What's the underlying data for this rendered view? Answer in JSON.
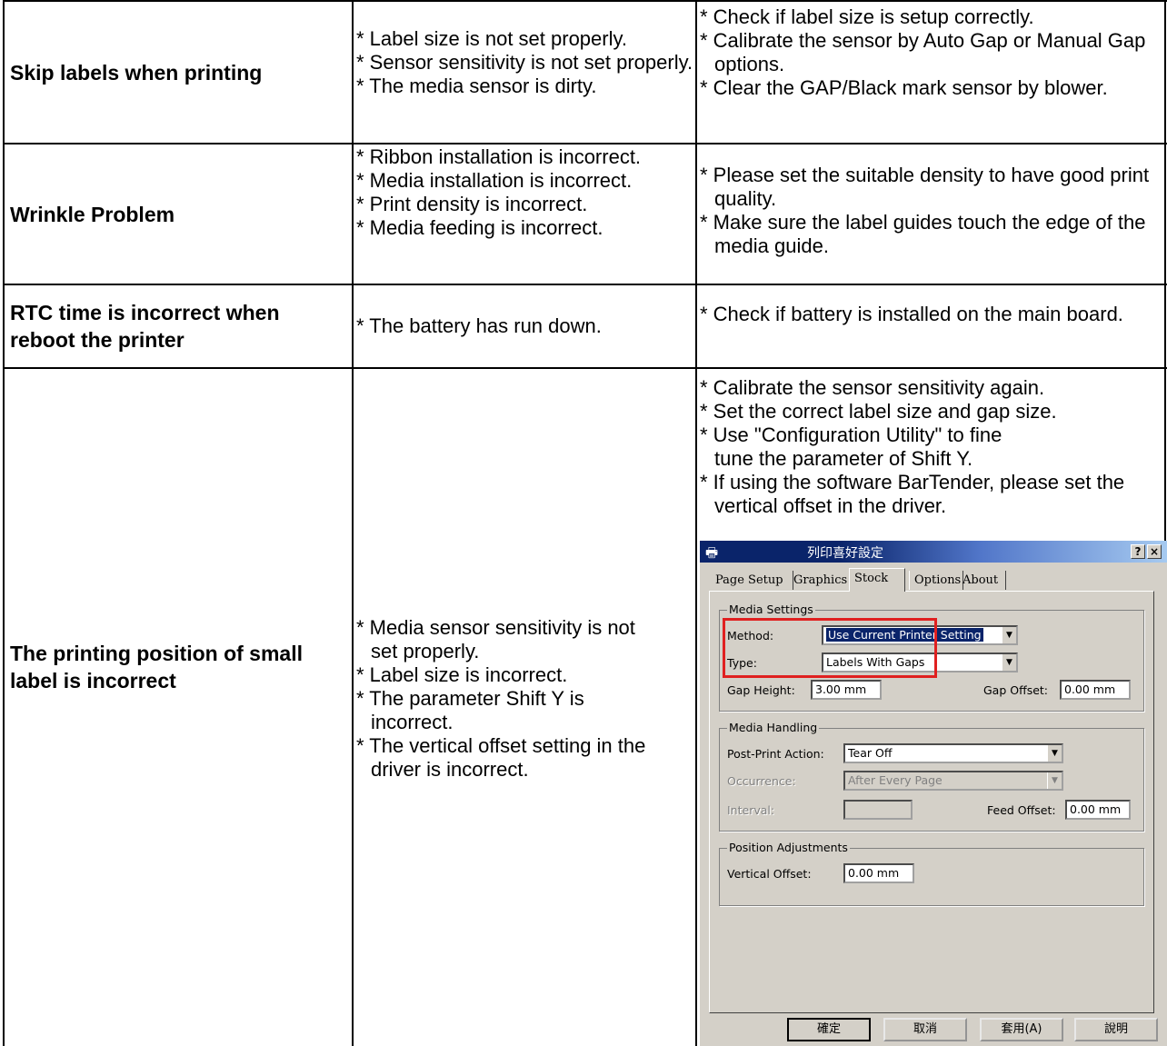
{
  "rows": [
    {
      "problem": "Skip labels when printing",
      "causes": [
        "* Label size is not set properly.",
        "* Sensor sensitivity is not set properly.",
        "* The media sensor is dirty."
      ],
      "solutions": [
        "* Check if label size is setup correctly.",
        "* Calibrate the sensor by Auto Gap or Manual Gap options.",
        "* Clear the GAP/Black mark sensor by blower."
      ]
    },
    {
      "problem": "Wrinkle Problem",
      "causes": [
        "* Ribbon installation is incorrect.",
        "* Media installation is incorrect.",
        "* Print density is incorrect.",
        "* Media feeding is incorrect."
      ],
      "solutions": [
        "* Please set the suitable density to have good print quality.",
        "* Make sure the label guides touch the edge of the media guide."
      ]
    },
    {
      "problem": "RTC time is incorrect when reboot the printer",
      "causes": [
        "* The battery has run down."
      ],
      "solutions": [
        "* Check if battery is installed on the main board."
      ]
    },
    {
      "problem": "The printing position of small label is incorrect",
      "causes": [
        "* Media sensor sensitivity is not set properly.",
        "* Label size is incorrect.",
        "* The parameter Shift Y is incorrect.",
        "* The vertical offset setting in the driver is incorrect."
      ],
      "solutions": [
        "* Calibrate the sensor sensitivity again.",
        "* Set the correct label size and gap size.",
        "* Use \"Configuration Utility\" to fine tune the parameter of Shift Y.",
        "* If using the software BarTender, please set the vertical offset in the driver."
      ]
    }
  ],
  "dialog": {
    "title": "列印喜好設定",
    "title_buttons": [
      "?",
      "×"
    ],
    "icons": [
      "printer-icon",
      "help-icon",
      "close-icon",
      "dropdown-arrow-icon"
    ],
    "tabs": [
      "Page Setup",
      "Graphics",
      "Stock",
      "Options",
      "About"
    ],
    "active_tab": "Stock",
    "media_settings": {
      "title": "Media Settings",
      "method_label": "Method:",
      "method_value": "Use Current Printer Setting",
      "type_label": "Type:",
      "type_value": "Labels With Gaps",
      "gap_height_label": "Gap Height:",
      "gap_height_value": "3.00 mm",
      "gap_offset_label": "Gap Offset:",
      "gap_offset_value": "0.00 mm"
    },
    "media_handling": {
      "title": "Media Handling",
      "post_print_label": "Post-Print Action:",
      "post_print_value": "Tear Off",
      "occurrence_label": "Occurrence:",
      "occurrence_value": "After Every Page",
      "interval_label": "Interval:",
      "interval_value": "",
      "feed_offset_label": "Feed Offset:",
      "feed_offset_value": "0.00 mm"
    },
    "position": {
      "title": "Position Adjustments",
      "vertical_offset_label": "Vertical Offset:",
      "vertical_offset_value": "0.00 mm"
    },
    "buttons": {
      "ok": "確定",
      "cancel": "取消",
      "apply": "套用(A)",
      "help": "說明"
    },
    "highlight_color": "#e02020"
  }
}
